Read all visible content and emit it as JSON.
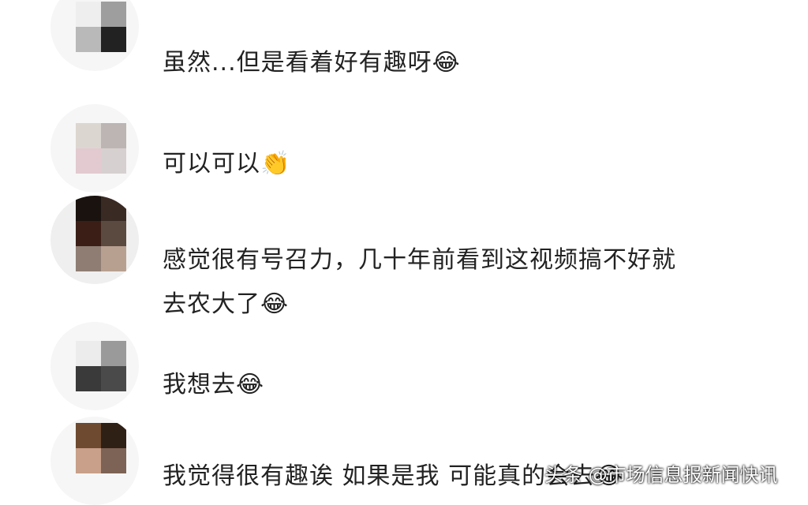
{
  "comments": [
    {
      "text": "虽然...但是看着好有趣呀",
      "emoji": "😂",
      "avatar_colors": [
        "#eeeeee",
        "#9e9e9e",
        "#b9b9b9",
        "#222222"
      ]
    },
    {
      "text": "可以可以",
      "emoji": "👏",
      "avatar_colors": [
        "#dcd6d0",
        "#bdb5b3",
        "#e2cad0",
        "#d6d0d0"
      ]
    },
    {
      "text_line1": "感觉很有号召力，几十年前看到这视频搞不好就",
      "text_line2": "去农大了",
      "emoji": "😂",
      "avatar_colors": [
        "#1a120e",
        "#3a2a24",
        "#3b1f17",
        "#5a4a40",
        "#8f7d73",
        "#b8a090"
      ]
    },
    {
      "text": "我想去",
      "emoji": "😂",
      "avatar_colors": [
        "#ececec",
        "#9a9a9a",
        "#3a3a3a",
        "#4a4a4a"
      ]
    },
    {
      "text": "我觉得很有趣诶 如果是我 可能真的会去",
      "emoji": "😂",
      "avatar_colors": [
        "#6e4a30",
        "#2f2016",
        "#c9a08a",
        "#7d6355"
      ]
    }
  ],
  "watermark": "头条 @市场信息报新闻快讯"
}
